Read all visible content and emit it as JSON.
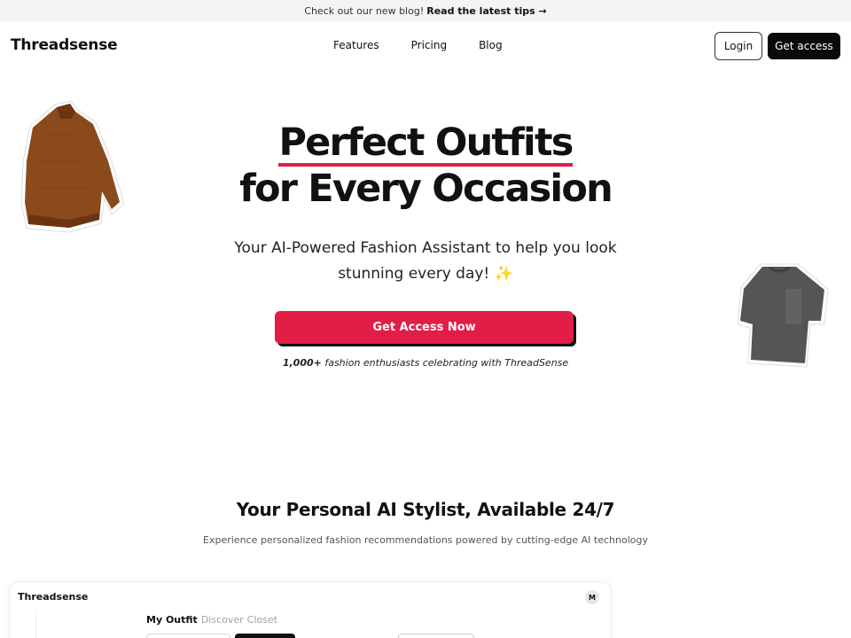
{
  "announcement": {
    "text": "Check out our new blog!",
    "link": "Read the latest tips →"
  },
  "nav": {
    "logo": "Threadsense",
    "links": [
      "Features",
      "Pricing",
      "Blog"
    ],
    "login": "Login",
    "get_access": "Get access"
  },
  "hero": {
    "title_line1": "Perfect Outfits",
    "title_line2": "for Every Occasion",
    "subtitle": "Your AI-Powered Fashion Assistant to help you look stunning every day! ✨",
    "cta": "Get Access Now",
    "proof_count": "1,000+",
    "proof_text": " fashion enthusiasts celebrating with ThreadSense"
  },
  "section": {
    "title": "Your Personal AI Stylist, Available 24/7",
    "subtitle": "Experience personalized fashion recommendations powered by cutting-edge AI technology"
  },
  "preview": {
    "logo": "Threadsense",
    "avatar": "M",
    "tabs": [
      "My Outfit",
      "Discover",
      "Closet"
    ]
  },
  "colors": {
    "accent": "#e11d48",
    "dark": "#0a0a0a",
    "announce_bg": "#f3f4f6"
  },
  "icons": [
    "sweater-image",
    "tshirt-image",
    "sparkles-icon"
  ]
}
